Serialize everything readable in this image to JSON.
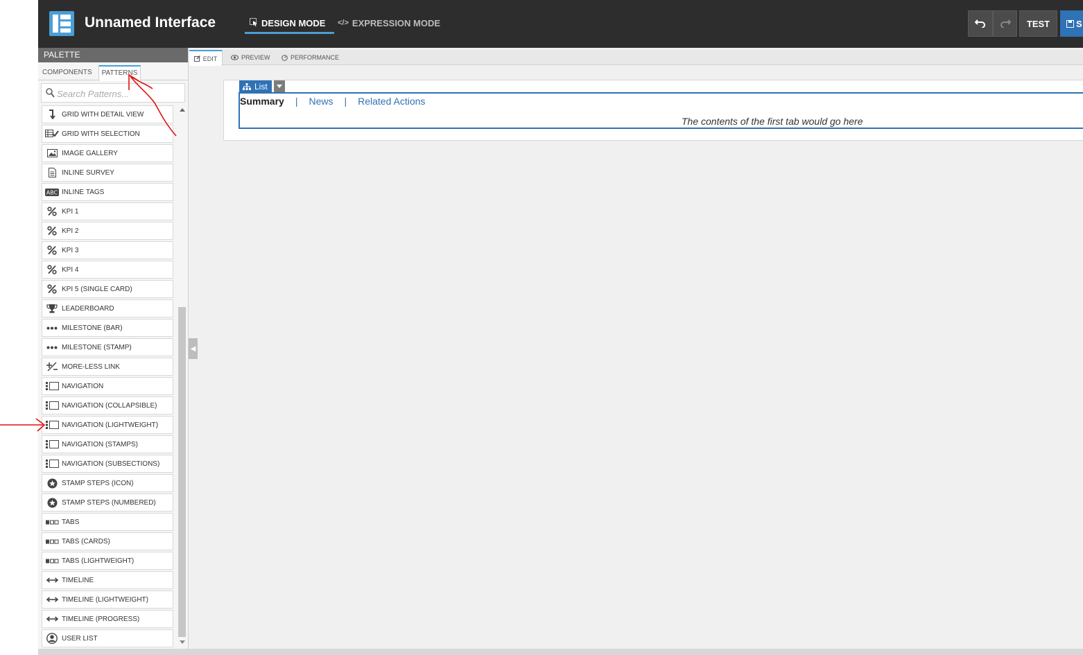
{
  "header": {
    "app_title": "Unnamed Interface",
    "modes": {
      "design": "DESIGN MODE",
      "expression": "EXPRESSION MODE"
    },
    "test_label": "TEST",
    "save_label": "S"
  },
  "palette": {
    "title": "PALETTE",
    "tabs": {
      "components": "COMPONENTS",
      "patterns": "PATTERNS"
    },
    "search_placeholder": "Search Patterns...",
    "items": [
      {
        "label": "GRID WITH DETAIL VIEW",
        "icon": "arrow-down-icon"
      },
      {
        "label": "GRID WITH SELECTION",
        "icon": "grid-check-icon"
      },
      {
        "label": "IMAGE GALLERY",
        "icon": "image-icon"
      },
      {
        "label": "INLINE SURVEY",
        "icon": "document-icon"
      },
      {
        "label": "INLINE TAGS",
        "icon": "abc-icon"
      },
      {
        "label": "KPI 1",
        "icon": "percent-icon"
      },
      {
        "label": "KPI 2",
        "icon": "percent-icon"
      },
      {
        "label": "KPI 3",
        "icon": "percent-icon"
      },
      {
        "label": "KPI 4",
        "icon": "percent-icon"
      },
      {
        "label": "KPI 5 (SINGLE CARD)",
        "icon": "percent-icon"
      },
      {
        "label": "LEADERBOARD",
        "icon": "trophy-icon"
      },
      {
        "label": "MILESTONE (BAR)",
        "icon": "dots-icon"
      },
      {
        "label": "MILESTONE (STAMP)",
        "icon": "dots-icon"
      },
      {
        "label": "MORE-LESS LINK",
        "icon": "plus-minus-icon"
      },
      {
        "label": "NAVIGATION",
        "icon": "navigation-icon"
      },
      {
        "label": "NAVIGATION (COLLAPSIBLE)",
        "icon": "navigation-icon"
      },
      {
        "label": "NAVIGATION (LIGHTWEIGHT)",
        "icon": "navigation-icon"
      },
      {
        "label": "NAVIGATION (STAMPS)",
        "icon": "navigation-icon"
      },
      {
        "label": "NAVIGATION (SUBSECTIONS)",
        "icon": "navigation-icon"
      },
      {
        "label": "STAMP STEPS (ICON)",
        "icon": "star-circle-icon"
      },
      {
        "label": "STAMP STEPS (NUMBERED)",
        "icon": "star-circle-icon"
      },
      {
        "label": "TABS",
        "icon": "tabs-icon"
      },
      {
        "label": "TABS (CARDS)",
        "icon": "tabs-icon"
      },
      {
        "label": "TABS (LIGHTWEIGHT)",
        "icon": "tabs-icon"
      },
      {
        "label": "TIMELINE",
        "icon": "double-arrow-icon"
      },
      {
        "label": "TIMELINE (LIGHTWEIGHT)",
        "icon": "double-arrow-icon"
      },
      {
        "label": "TIMELINE (PROGRESS)",
        "icon": "double-arrow-icon"
      },
      {
        "label": "USER LIST",
        "icon": "user-circle-icon"
      }
    ]
  },
  "editor": {
    "tabs": {
      "edit": "EDIT",
      "preview": "PREVIEW",
      "performance": "PERFORMANCE"
    },
    "list_badge": "List",
    "nav": {
      "summary": "Summary",
      "sep": "|",
      "news": "News",
      "related": "Related Actions"
    },
    "tab_content": "The contents of the first tab would go here"
  },
  "colors": {
    "header_bg": "#2d2d2d",
    "accent": "#4a9fd5",
    "link_blue": "#2f72b5",
    "annotation_red": "#e01010"
  }
}
